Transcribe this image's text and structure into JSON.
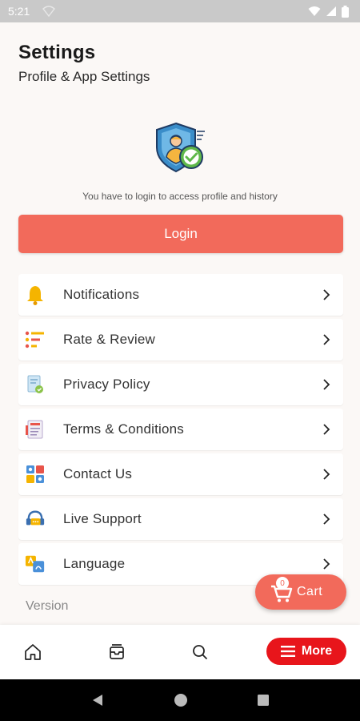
{
  "status_bar": {
    "time": "5:21"
  },
  "header": {
    "title": "Settings",
    "subtitle": "Profile & App Settings"
  },
  "login": {
    "message": "You have to login to access profile and history",
    "button_label": "Login"
  },
  "menu": {
    "items": [
      {
        "label": "Notifications",
        "icon": "bell-icon"
      },
      {
        "label": "Rate & Review",
        "icon": "rate-review-icon"
      },
      {
        "label": "Privacy Policy",
        "icon": "privacy-policy-icon"
      },
      {
        "label": "Terms & Conditions",
        "icon": "terms-icon"
      },
      {
        "label": "Contact Us",
        "icon": "contact-icon"
      },
      {
        "label": "Live Support",
        "icon": "headset-icon"
      },
      {
        "label": "Language",
        "icon": "language-icon"
      }
    ]
  },
  "version": {
    "label": "Version"
  },
  "cart": {
    "count": "0",
    "label": "Cart"
  },
  "bottom_nav": {
    "more_label": "More"
  },
  "colors": {
    "accent": "#f26a5b",
    "more_red": "#e8151b",
    "background": "#fbf8f6"
  }
}
